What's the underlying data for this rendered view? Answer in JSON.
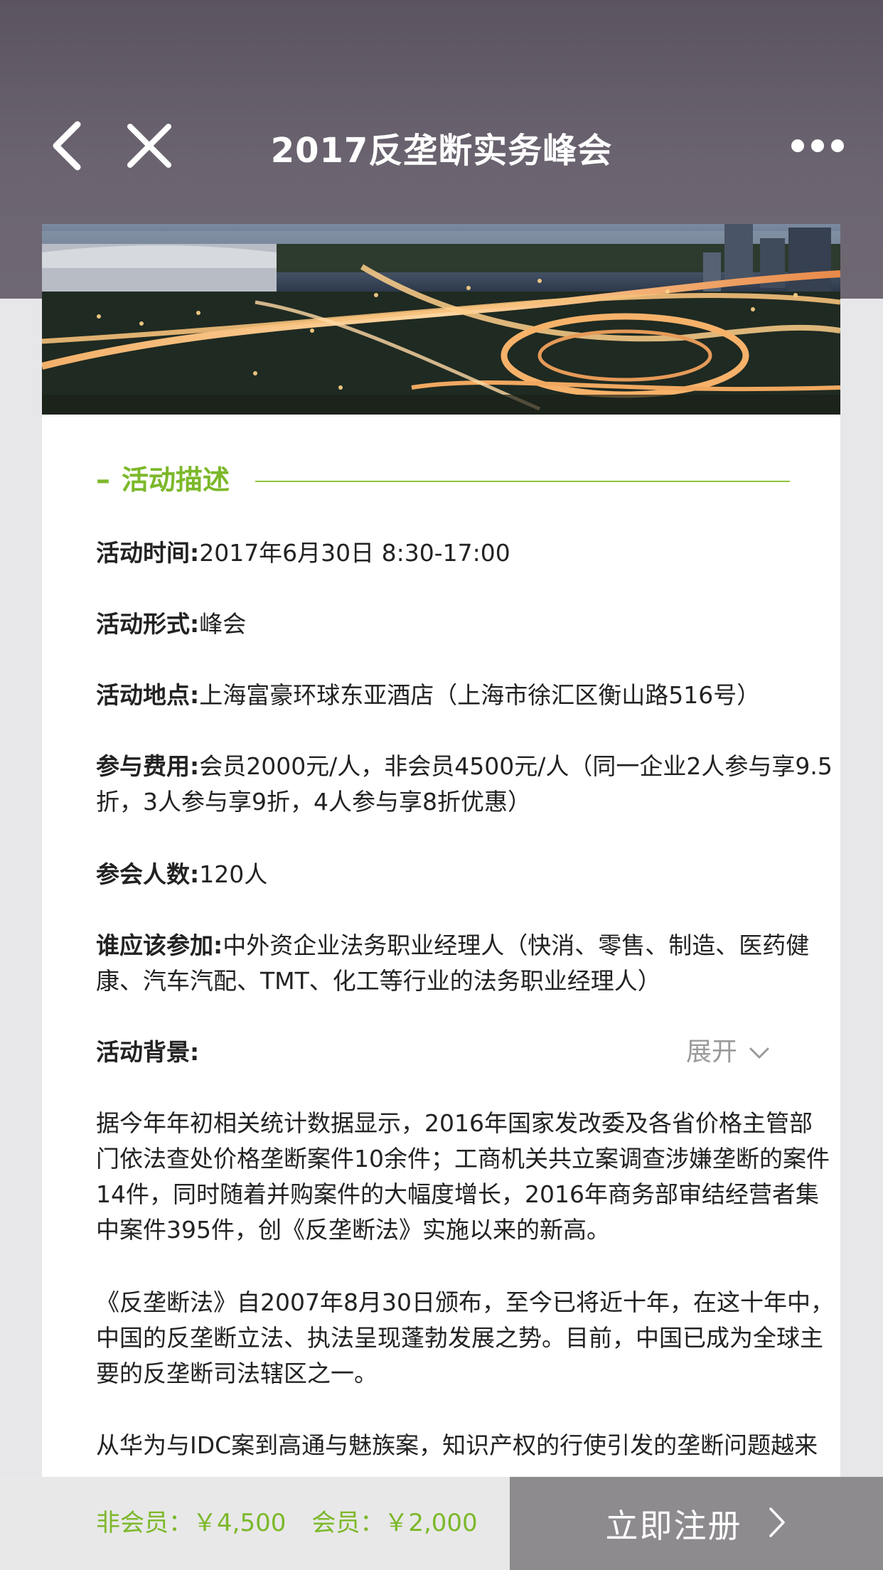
{
  "header": {
    "title": "2017反垄断实务峰会",
    "back_icon": "chevron-left-icon",
    "close_icon": "close-icon",
    "more_icon": "more-dots-icon"
  },
  "section": {
    "dash": "–",
    "title": "活动描述"
  },
  "details": [
    {
      "key": "活动时间:",
      "value": "2017年6月30日 8:30-17:00"
    },
    {
      "key": "活动形式:",
      "value": "峰会"
    },
    {
      "key": "活动地点:",
      "value": "上海富豪环球东亚酒店（上海市徐汇区衡山路516号）"
    },
    {
      "key": "参与费用:",
      "value": "会员2000元/人，非会员4500元/人（同一企业2人参与享9.5折，3人参与享9折，4人参与享8折优惠）"
    },
    {
      "key": "参会人数:",
      "value": "120人"
    },
    {
      "key": "谁应该参加:",
      "value": "中外资企业法务职业经理人（快消、零售、制造、医药健康、汽车汽配、TMT、化工等行业的法务职业经理人）"
    },
    {
      "key": "活动背景:",
      "value": ""
    }
  ],
  "expand_label": "展开",
  "background_paragraphs": [
    "据今年年初相关统计数据显示，2016年国家发改委及各省价格主管部门依法查处价格垄断案件10余件；工商机关共立案调查涉嫌垄断的案件14件，同时随着并购案件的大幅度增长，2016年商务部审结经营者集中案件395件，创《反垄断法》实施以来的新高。",
    "《反垄断法》自2007年8月30日颁布，至今已将近十年，在这十年中，中国的反垄断立法、执法呈现蓬勃发展之势。目前，中国已成为全球主要的反垄断司法辖区之一。",
    "从华为与IDC案到高通与魅族案，知识产权的行使引发的垄断问题越来"
  ],
  "footer": {
    "non_member_price": "非会员：￥4,500",
    "member_price": "会员：￥2,000",
    "register_label": "立即注册",
    "register_arrow_icon": "chevron-right-icon"
  },
  "colors": {
    "accent": "#7cb82a",
    "header": "#635c68",
    "register_bg": "#8e8b8f"
  }
}
